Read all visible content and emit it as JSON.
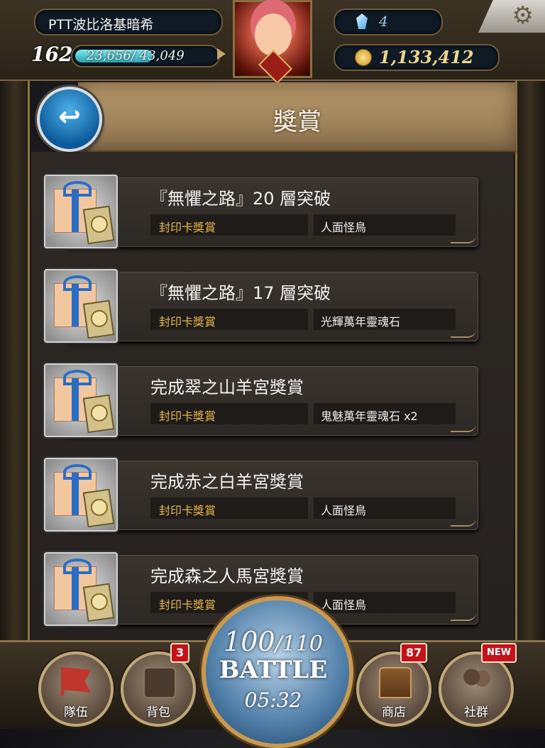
{
  "player": {
    "name": "PTT波比洛基暗希",
    "level": "162",
    "exp_text": "23,656/ 43,049",
    "exp_fraction": 0.55,
    "gems": "4",
    "gold": "1,133,412"
  },
  "header": {
    "title": "獎賞"
  },
  "rewards": [
    {
      "title": "『無懼之路』20 層突破",
      "type": "封印卡獎賞",
      "item": "人面怪鳥"
    },
    {
      "title": "『無懼之路』17 層突破",
      "type": "封印卡獎賞",
      "item": "光輝萬年靈魂石"
    },
    {
      "title": "完成翠之山羊宮獎賞",
      "type": "封印卡獎賞",
      "item": "鬼魅萬年靈魂石 x2"
    },
    {
      "title": "完成赤之白羊宮獎賞",
      "type": "封印卡獎賞",
      "item": "人面怪鳥"
    },
    {
      "title": "完成森之人馬宮獎賞",
      "type": "封印卡獎賞",
      "item": "人面怪鳥"
    }
  ],
  "nav": {
    "team": {
      "label": "隊伍"
    },
    "bag": {
      "label": "背包",
      "badge": "3"
    },
    "shop": {
      "label": "商店",
      "badge": "87"
    },
    "social": {
      "label": "社群",
      "badge": "NEW"
    }
  },
  "battle": {
    "energy_current": "100",
    "energy_max": "/110",
    "label": "BATTLE",
    "timer": "05:32"
  },
  "colors": {
    "accent_gold": "#e9b84e",
    "frame": "#8a7348",
    "badge_red": "#c4121a",
    "back_blue": "#1a7dc4"
  },
  "icons": {
    "back": "back-arrow-icon",
    "settings": "gear-icon",
    "gem": "diamond-icon",
    "gold": "coin-icon",
    "reward": "gift-box-icon"
  }
}
